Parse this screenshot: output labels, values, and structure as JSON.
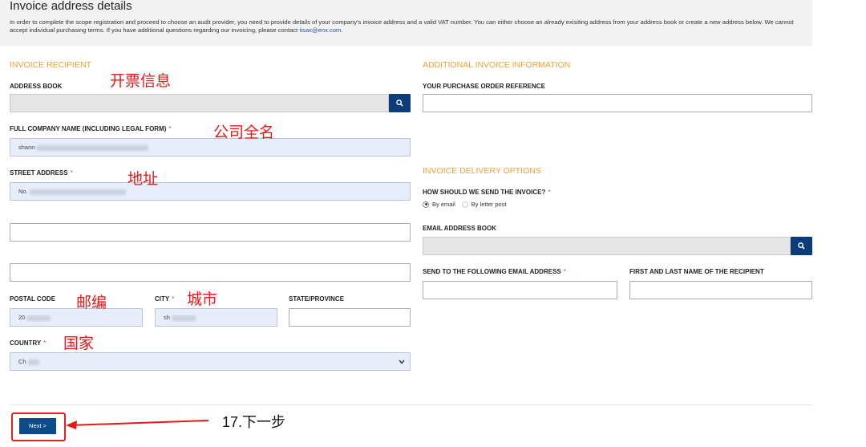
{
  "header": {
    "title": "Invoice address details",
    "intro_text": "In order to complete the scope registration and proceed to choose an audit provider, you need to provide details of your company's invoice address and a valid VAT number. You can either choose an already exisiting address from your address book or create a new address below. We cannot accept individual purchasing terms. If you have additional questions regarding our invoicing, please contact ",
    "contact_email": "tisax@enx.com",
    "intro_end": "."
  },
  "invoice_recipient": {
    "section_title": "INVOICE RECIPIENT",
    "address_book_label": "ADDRESS BOOK",
    "company_name_label": "FULL COMPANY NAME (INCLUDING LEGAL FORM)",
    "company_name_value": "shann",
    "street_label": "STREET ADDRESS",
    "street_value": "No.",
    "postal_label": "POSTAL CODE",
    "postal_value": "20",
    "city_label": "CITY",
    "city_value": "sh",
    "state_label": "STATE/PROVINCE",
    "country_label": "COUNTRY",
    "country_value": "Ch",
    "required_mark": "*"
  },
  "additional_info": {
    "section_title": "ADDITIONAL INVOICE INFORMATION",
    "po_label": "YOUR PURCHASE ORDER REFERENCE"
  },
  "delivery": {
    "section_title": "INVOICE DELIVERY OPTIONS",
    "how_label": "HOW SHOULD WE SEND THE INVOICE?",
    "option_email": "By email",
    "option_post": "By letter post",
    "email_book_label": "EMAIL ADDRESS BOOK",
    "send_to_label": "SEND TO THE FOLLOWING EMAIL ADDRESS",
    "recipient_name_label": "FIRST AND LAST NAME OF THE RECIPIENT"
  },
  "actions": {
    "next_label": "Next >"
  },
  "annotations": {
    "invoice_info": "开票信息",
    "company_full_name": "公司全名",
    "address": "地址",
    "postal": "邮编",
    "city": "城市",
    "country": "国家",
    "next_step": "17.下一步"
  },
  "colors": {
    "accent_orange": "#f0a030",
    "button_navy": "#0c3d7a",
    "annotation_red": "#e81818",
    "link_blue": "#1e5aa8"
  }
}
